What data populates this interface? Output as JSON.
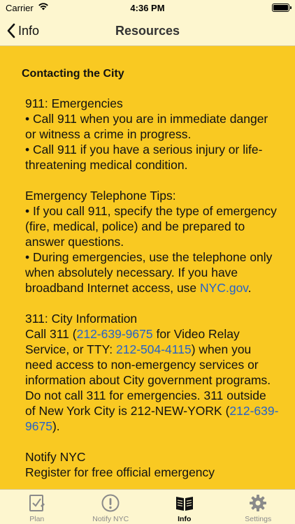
{
  "status": {
    "carrier": "Carrier",
    "time": "4:36 PM"
  },
  "nav": {
    "back_label": "Info",
    "title": "Resources"
  },
  "content": {
    "heading": "Contacting the City",
    "emergencies": {
      "title": "911: Emergencies",
      "line1": "• Call 911 when you are in immediate danger or witness a crime in progress.",
      "line2": "• Call 911 if you have a serious injury or life-threatening medical condition."
    },
    "tips": {
      "title": "Emergency Telephone Tips:",
      "line1": "• If you call 911, specify the type of emergency (fire, medical, police) and be prepared to answer questions.",
      "line2_text": "• During emergencies, use the telephone only when absolutely necessary. If you have broadband Internet access, use ",
      "line2_link": "NYC.gov",
      "line2_end": "."
    },
    "city_info": {
      "title": "311: City Information",
      "t1": "Call 311 (",
      "link1": "212-639-9675",
      "t2": " for Video Relay Service, or TTY: ",
      "link2": "212-504-4115",
      "t3": ") when you need access to non-emergency services or information about City government programs. Do not call 311 for emergencies. 311 outside of New York City is 212-NEW-YORK (",
      "link3": "212-639-9675",
      "t4": ")."
    },
    "notify": {
      "title": "Notify NYC",
      "line1": "Register for free official emergency"
    }
  },
  "tabs": [
    {
      "label": "Plan",
      "icon": "checklist-icon",
      "active": false
    },
    {
      "label": "Notify NYC",
      "icon": "exclamation-circle-icon",
      "active": false
    },
    {
      "label": "Info",
      "icon": "open-book-icon",
      "active": true
    },
    {
      "label": "Settings",
      "icon": "gear-icon",
      "active": false
    }
  ],
  "colors": {
    "background": "#f9c922",
    "bar": "#fdf6cf",
    "link": "#2563c9"
  }
}
